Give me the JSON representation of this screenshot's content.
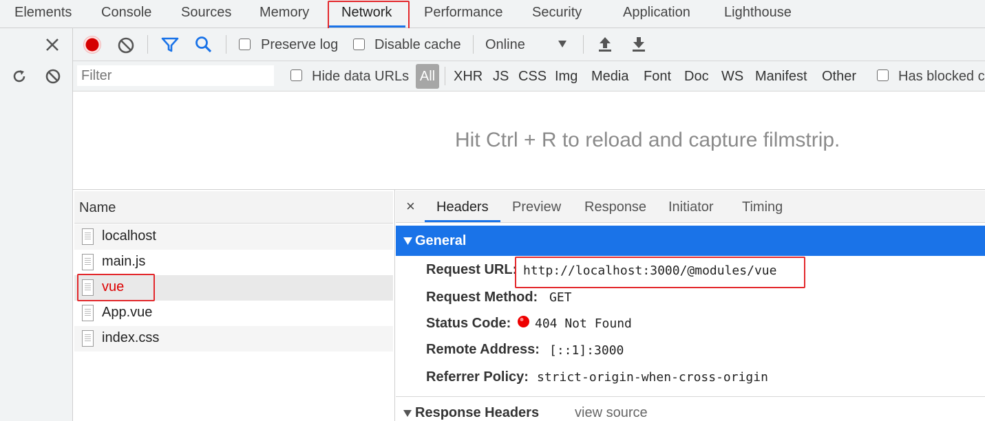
{
  "tabs": [
    "Elements",
    "Console",
    "Sources",
    "Memory",
    "Network",
    "Performance",
    "Security",
    "Application",
    "Lighthouse"
  ],
  "toolbar": {
    "preserve_log": "Preserve log",
    "disable_cache": "Disable cache",
    "throttle": "Online"
  },
  "filter_bar": {
    "placeholder": "Filter",
    "hide_data_urls": "Hide data URLs",
    "all": "All",
    "types": [
      "XHR",
      "JS",
      "CSS",
      "Img",
      "Media",
      "Font",
      "Doc",
      "WS",
      "Manifest",
      "Other"
    ],
    "has_blocked": "Has blocked c"
  },
  "filmstrip_hint": "Hit Ctrl + R to reload and capture filmstrip.",
  "requests": {
    "header": "Name",
    "items": [
      "localhost",
      "main.js",
      "vue",
      "App.vue",
      "index.css"
    ],
    "selected_index": 2
  },
  "detail": {
    "close": "×",
    "tabs": [
      "Headers",
      "Preview",
      "Response",
      "Initiator",
      "Timing"
    ],
    "general_title": "General",
    "fields": [
      {
        "key": "Request URL:",
        "value": "http://localhost:3000/@modules/vue"
      },
      {
        "key": "Request Method:",
        "value": "GET"
      },
      {
        "key": "Status Code:",
        "value": "404 Not Found"
      },
      {
        "key": "Remote Address:",
        "value": "[::1]:3000"
      },
      {
        "key": "Referrer Policy:",
        "value": "strict-origin-when-cross-origin"
      }
    ],
    "response_headers_title": "Response Headers",
    "view_source": "view source"
  },
  "colors": {
    "accent": "#1a73e8",
    "highlight_red": "#e3272b",
    "record_red": "#d50000",
    "selected_row": "#e9e9e9"
  }
}
